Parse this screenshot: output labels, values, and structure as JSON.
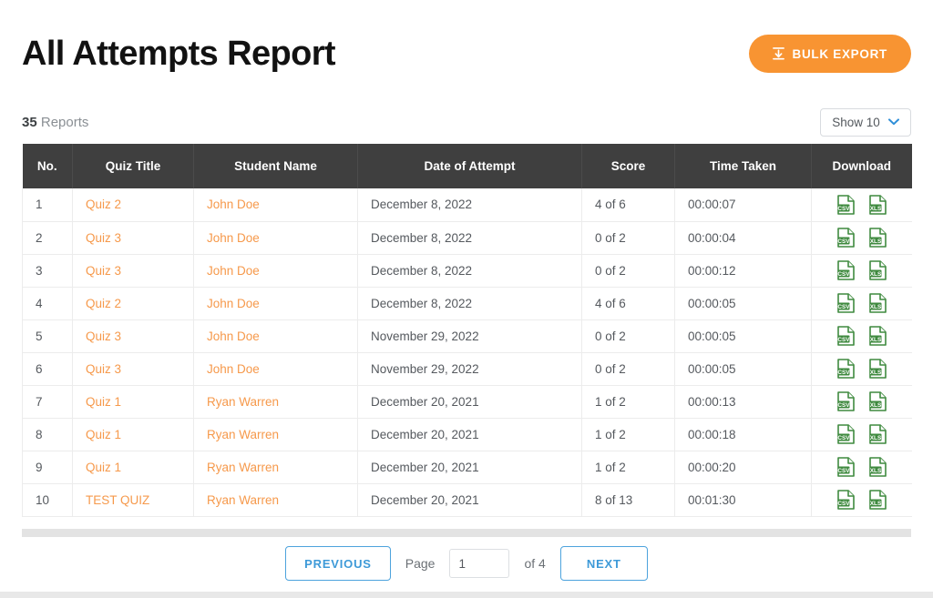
{
  "header": {
    "title": "All Attempts Report",
    "bulk_export_label": "BULK EXPORT",
    "bulk_export_icon": "download-icon",
    "accent_orange": "#f89432",
    "link_orange": "#f6994b",
    "accent_blue": "#3e9ad8",
    "header_bg": "#3f3f3f"
  },
  "subbar": {
    "count": "35",
    "count_label": "Reports",
    "show_select_label": "Show 10",
    "show_select_icon": "chevron-down-icon"
  },
  "table": {
    "columns": [
      "No.",
      "Quiz Title",
      "Student Name",
      "Date of Attempt",
      "Score",
      "Time Taken",
      "Download"
    ],
    "rows": [
      {
        "no": "1",
        "quiz": "Quiz 2",
        "student": "John Doe",
        "date": "December 8, 2022",
        "score": "4 of 6",
        "time": "00:00:07"
      },
      {
        "no": "2",
        "quiz": "Quiz 3",
        "student": "John Doe",
        "date": "December 8, 2022",
        "score": "0 of 2",
        "time": "00:00:04"
      },
      {
        "no": "3",
        "quiz": "Quiz 3",
        "student": "John Doe",
        "date": "December 8, 2022",
        "score": "0 of 2",
        "time": "00:00:12"
      },
      {
        "no": "4",
        "quiz": "Quiz 2",
        "student": "John Doe",
        "date": "December 8, 2022",
        "score": "4 of 6",
        "time": "00:00:05"
      },
      {
        "no": "5",
        "quiz": "Quiz 3",
        "student": "John Doe",
        "date": "November 29, 2022",
        "score": "0 of 2",
        "time": "00:00:05"
      },
      {
        "no": "6",
        "quiz": "Quiz 3",
        "student": "John Doe",
        "date": "November 29, 2022",
        "score": "0 of 2",
        "time": "00:00:05"
      },
      {
        "no": "7",
        "quiz": "Quiz 1",
        "student": "Ryan Warren",
        "date": "December 20, 2021",
        "score": "1 of 2",
        "time": "00:00:13"
      },
      {
        "no": "8",
        "quiz": "Quiz 1",
        "student": "Ryan Warren",
        "date": "December 20, 2021",
        "score": "1 of 2",
        "time": "00:00:18"
      },
      {
        "no": "9",
        "quiz": "Quiz 1",
        "student": "Ryan Warren",
        "date": "December 20, 2021",
        "score": "1 of 2",
        "time": "00:00:20"
      },
      {
        "no": "10",
        "quiz": "TEST QUIZ",
        "student": "Ryan Warren",
        "date": "December 20, 2021",
        "score": "8 of 13",
        "time": "00:01:30"
      }
    ],
    "download_icons": [
      "csv-file-icon",
      "xls-file-icon"
    ],
    "csv_label": "CSV",
    "xls_label": "XLS",
    "file_icon_color": "#3f8a3f"
  },
  "pagination": {
    "previous_label": "PREVIOUS",
    "next_label": "NEXT",
    "page_label": "Page",
    "page_value": "1",
    "of_label": "of 4"
  }
}
